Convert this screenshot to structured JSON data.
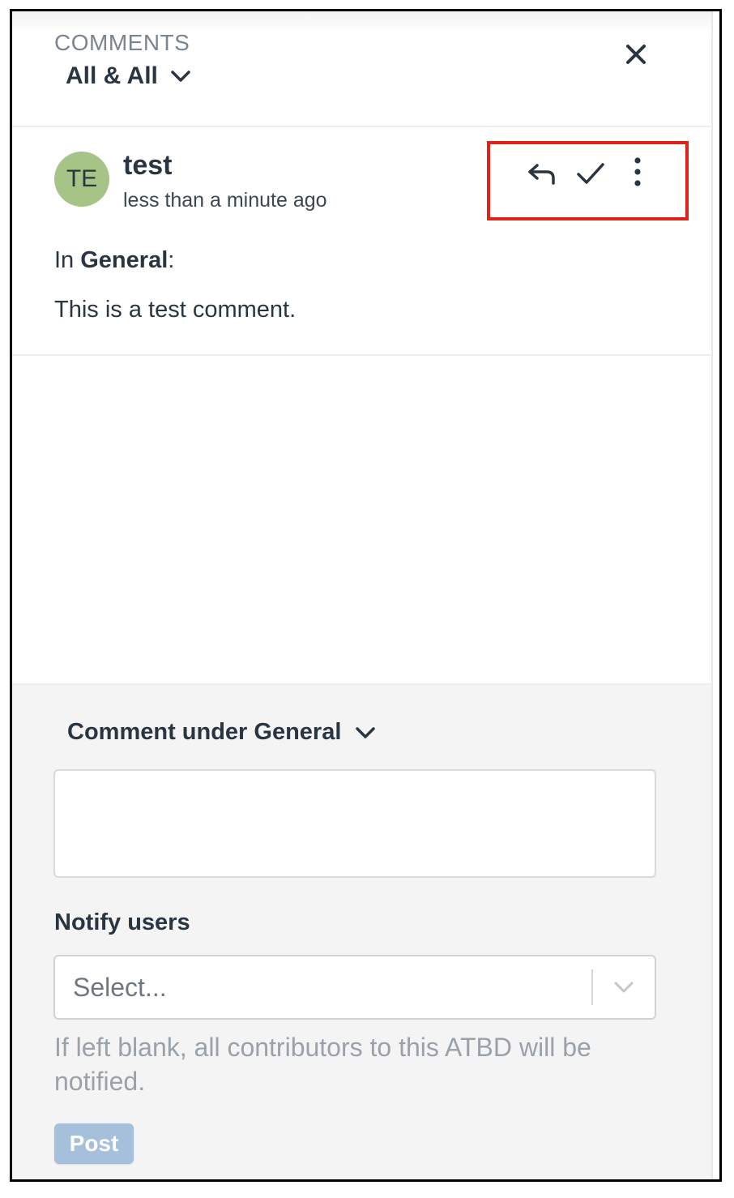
{
  "header": {
    "label": "COMMENTS",
    "filter_value": "All & All"
  },
  "comment": {
    "avatar_initials": "TE",
    "author": "test",
    "time": "less than a minute ago",
    "context_prefix": "In ",
    "context_section": "General",
    "context_suffix": ":",
    "body": "This is a test comment."
  },
  "form": {
    "section_select_value": "Comment under General",
    "comment_input_value": "",
    "notify_label": "Notify users",
    "notify_placeholder": "Select...",
    "hint": "If left blank, all contributors to this ATBD will be notified.",
    "post_label": "Post"
  },
  "colors": {
    "avatar_bg": "#a7c487",
    "highlight_border": "#e0221a",
    "post_button_bg": "#a6c0dc",
    "text_primary": "#2a3542",
    "footer_bg": "#f4f4f5"
  },
  "icons": {
    "filter_dropdown": "chevron-down-icon",
    "close": "close-icon",
    "reply": "reply-icon",
    "resolve": "check-icon",
    "more": "more-vertical-icon",
    "section_dropdown": "chevron-down-icon",
    "notify_dropdown": "chevron-down-icon"
  }
}
